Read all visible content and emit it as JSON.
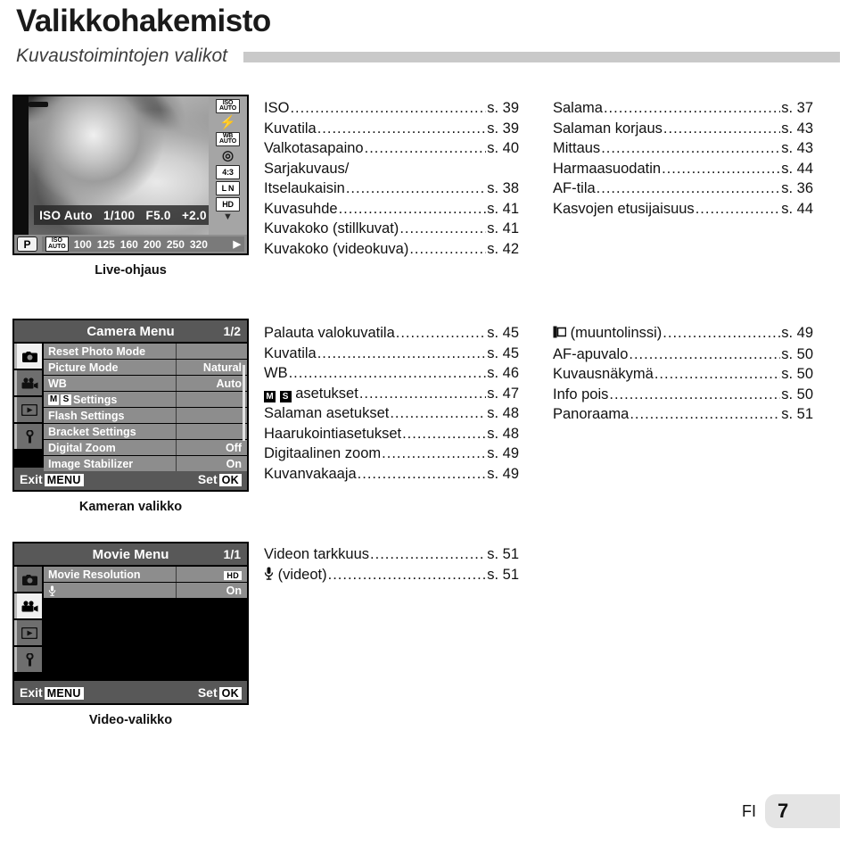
{
  "header": {
    "title": "Valikkohakemisto",
    "subtitle": "Kuvaustoimintojen valikot"
  },
  "liveview": {
    "caption": "Live-ohjaus",
    "info": [
      "ISO Auto",
      "1/100",
      "F5.0",
      "+2.0"
    ],
    "mode": "P",
    "iso_badge_top": "ISO",
    "iso_badge_bottom": "AUTO",
    "iso_values": [
      "100",
      "125",
      "160",
      "200",
      "250",
      "320"
    ],
    "next_arrow": "▶",
    "sidebar_icons": [
      {
        "name": "iso-auto-icon",
        "top": "ISO",
        "bottom": "AUTO"
      },
      {
        "name": "flash-mode-icon",
        "glyph": "⚡"
      },
      {
        "name": "white-balance-auto-icon",
        "top": "WB",
        "bottom": "AUTO"
      },
      {
        "name": "drive-mode-icon",
        "glyph": "◎"
      },
      {
        "name": "aspect-ratio-icon",
        "single": "4:3"
      },
      {
        "name": "image-quality-icon",
        "single": "L N"
      },
      {
        "name": "movie-quality-hd-icon",
        "single": "HD"
      }
    ],
    "sidebar_arrow": "▼"
  },
  "toc_shooting_mid": [
    {
      "label": "ISO",
      "page": "s. 39"
    },
    {
      "label": "Kuvatila",
      "page": "s. 39"
    },
    {
      "label": "Valkotasapaino",
      "page": "s. 40"
    },
    {
      "label": "Sarjakuvaus/",
      "page": "",
      "nodots": true
    },
    {
      "label": "Itselaukaisin",
      "page": "s. 38"
    },
    {
      "label": "Kuvasuhde",
      "page": "s. 41"
    },
    {
      "label": "Kuvakoko (stillkuvat)",
      "page": "s. 41"
    },
    {
      "label": "Kuvakoko (videokuva)",
      "page": "s. 42"
    }
  ],
  "toc_shooting_right": [
    {
      "label": "Salama",
      "page": "s. 37"
    },
    {
      "label": "Salaman korjaus",
      "page": "s. 43"
    },
    {
      "label": "Mittaus",
      "page": "s. 43"
    },
    {
      "label": "Harmaasuodatin",
      "page": "s. 44"
    },
    {
      "label": "AF-tila",
      "page": "s. 36"
    },
    {
      "label": "Kasvojen etusijaisuus",
      "page": "s. 44"
    }
  ],
  "camera_menu": {
    "title": "Camera Menu",
    "page_index": "1/2",
    "caption": "Kameran valikko",
    "tabs": [
      {
        "name": "tab-photo",
        "icon": "camera-icon",
        "active": true
      },
      {
        "name": "tab-movie",
        "icon": "movie-camera-icon",
        "active": false
      },
      {
        "name": "tab-playback",
        "icon": "playback-icon",
        "active": false
      },
      {
        "name": "tab-setup",
        "icon": "wrench-icon",
        "active": false
      }
    ],
    "rows": [
      {
        "label": "Reset Photo Mode",
        "value": ""
      },
      {
        "label": "Picture Mode",
        "value": "Natural"
      },
      {
        "label": "WB",
        "value": "Auto"
      },
      {
        "label": "Settings",
        "value": "",
        "prefix_glyphs": [
          "M",
          "S"
        ]
      },
      {
        "label": "Flash Settings",
        "value": ""
      },
      {
        "label": "Bracket Settings",
        "value": ""
      },
      {
        "label": "Digital Zoom",
        "value": "Off"
      },
      {
        "label": "Image Stabilizer",
        "value": "On"
      }
    ],
    "exit_label": "Exit",
    "exit_badge": "MENU",
    "set_label": "Set",
    "set_badge": "OK"
  },
  "toc_camera_mid": [
    {
      "label": "Palauta valokuvatila",
      "page": "s. 45"
    },
    {
      "label": "Kuvatila",
      "page": "s. 45"
    },
    {
      "label": "WB",
      "page": "s. 46"
    },
    {
      "label": "asetukset",
      "page": "s. 47",
      "glyphs_inv": [
        "M",
        "S"
      ]
    },
    {
      "label": "Salaman asetukset",
      "page": "s. 48"
    },
    {
      "label": "Haarukointiasetukset",
      "page": "s. 48"
    },
    {
      "label": "Digitaalinen zoom",
      "page": "s. 49"
    },
    {
      "label": "Kuvanvakaaja",
      "page": "s. 49"
    }
  ],
  "toc_camera_right": [
    {
      "label": "(muuntolinssi)",
      "page": "s. 49",
      "glyph": "converter-lens-icon"
    },
    {
      "label": "AF-apuvalo",
      "page": "s. 50"
    },
    {
      "label": "Kuvausnäkymä",
      "page": "s. 50"
    },
    {
      "label": "Info pois",
      "page": "s. 50"
    },
    {
      "label": "Panoraama",
      "page": "s. 51"
    }
  ],
  "movie_menu": {
    "title": "Movie Menu",
    "page_index": "1/1",
    "caption": "Video-valikko",
    "tabs": [
      {
        "name": "tab-photo",
        "icon": "camera-icon",
        "active": false
      },
      {
        "name": "tab-movie",
        "icon": "movie-camera-icon",
        "active": true
      },
      {
        "name": "tab-playback",
        "icon": "playback-icon",
        "active": false
      },
      {
        "name": "tab-setup",
        "icon": "wrench-icon",
        "active": false
      }
    ],
    "rows": [
      {
        "label": "Movie Resolution",
        "value": "HD",
        "value_is_badge": true
      },
      {
        "label": "",
        "value": "On",
        "label_glyph": "microphone-icon"
      }
    ],
    "exit_label": "Exit",
    "exit_badge": "MENU",
    "set_label": "Set",
    "set_badge": "OK"
  },
  "toc_movie_mid": [
    {
      "label": "Videon tarkkuus",
      "page": "s. 51"
    },
    {
      "label": "(videot)",
      "page": "s. 51",
      "glyph": "microphone-icon"
    }
  ],
  "footer": {
    "language": "FI",
    "page_number": "7"
  }
}
